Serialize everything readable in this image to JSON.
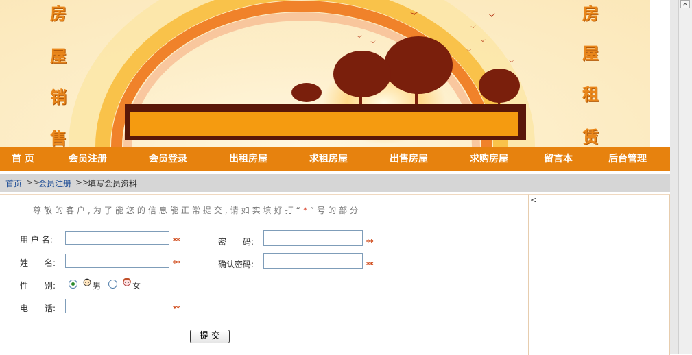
{
  "banner": {
    "left_slogan": [
      "房",
      "屋",
      "销",
      "售"
    ],
    "right_slogan": [
      "房",
      "屋",
      "租",
      "赁"
    ]
  },
  "nav": {
    "items": [
      "首 页",
      "会员注册",
      "会员登录",
      "出租房屋",
      "求租房屋",
      "出售房屋",
      "求购房屋",
      "留言本",
      "后台管理"
    ]
  },
  "breadcrumb": {
    "home": "首页",
    "separator": ">>",
    "register": "会员注册",
    "current": "填写会员资料"
  },
  "form": {
    "notice_before": "尊敬的客户,为了能您的信息能正常提交,请如实填好打“",
    "notice_star": "*",
    "notice_after": "”号的部分",
    "username_label": "用 户 名:",
    "password_label": "密　　码:",
    "realname_label": "姓　　名:",
    "confirm_label": "确认密码:",
    "gender_label": "性　　别:",
    "male": "男",
    "female": "女",
    "phone_label": "电　　话:",
    "required_mark": "**",
    "submit_label": "提 交",
    "username_value": "",
    "password_value": "",
    "realname_value": "",
    "confirm_value": "",
    "phone_value": ""
  },
  "right_panel": {
    "arrow": "<"
  },
  "colors": {
    "nav_bg": "#e7820e",
    "slogan": "#e9861a",
    "link": "#1f4e96",
    "required": "#d04a1a"
  }
}
